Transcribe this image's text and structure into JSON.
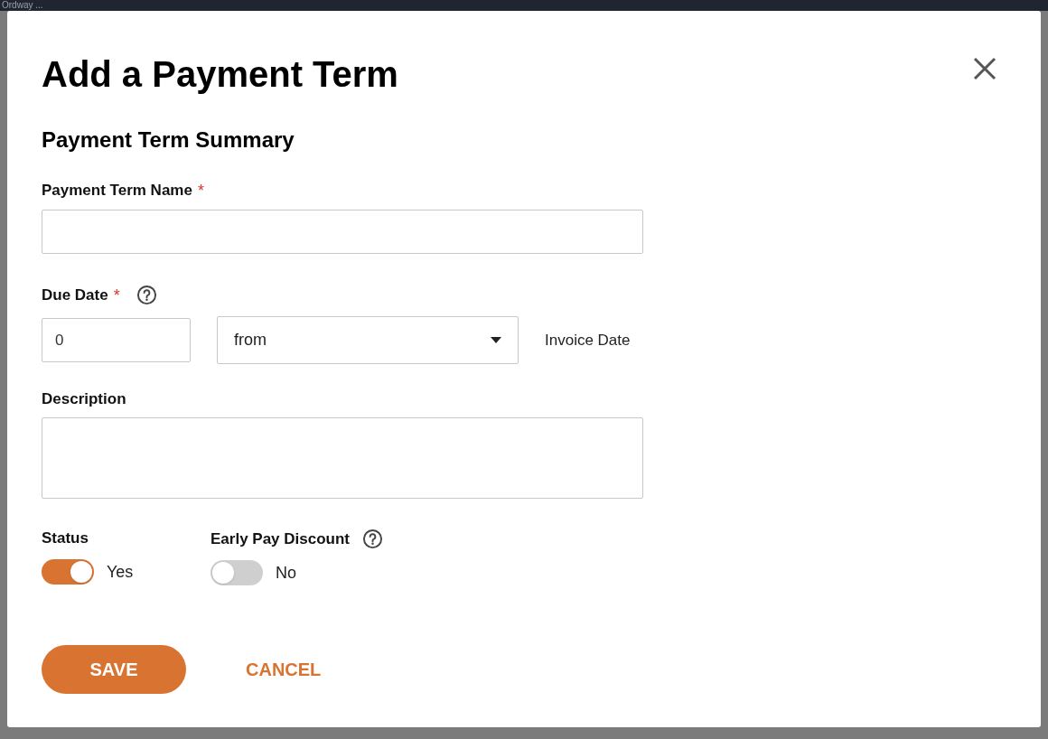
{
  "background": {
    "app_title": "Ordway ..."
  },
  "dialog": {
    "title": "Add a Payment Term",
    "section_title": "Payment Term Summary",
    "name_field": {
      "label": "Payment Term Name",
      "required_mark": "*"
    },
    "due_date": {
      "label": "Due Date",
      "required_mark": "*",
      "days": "0",
      "relation": "from",
      "reference": "Invoice Date"
    },
    "description": {
      "label": "Description"
    },
    "toggles": [
      {
        "label": "Status",
        "on": true,
        "value_text": "Yes",
        "help": false
      },
      {
        "label": "Early Pay Discount",
        "on": false,
        "value_text": "No",
        "help": true
      }
    ],
    "buttons": {
      "save": "SAVE",
      "cancel": "CANCEL"
    }
  }
}
